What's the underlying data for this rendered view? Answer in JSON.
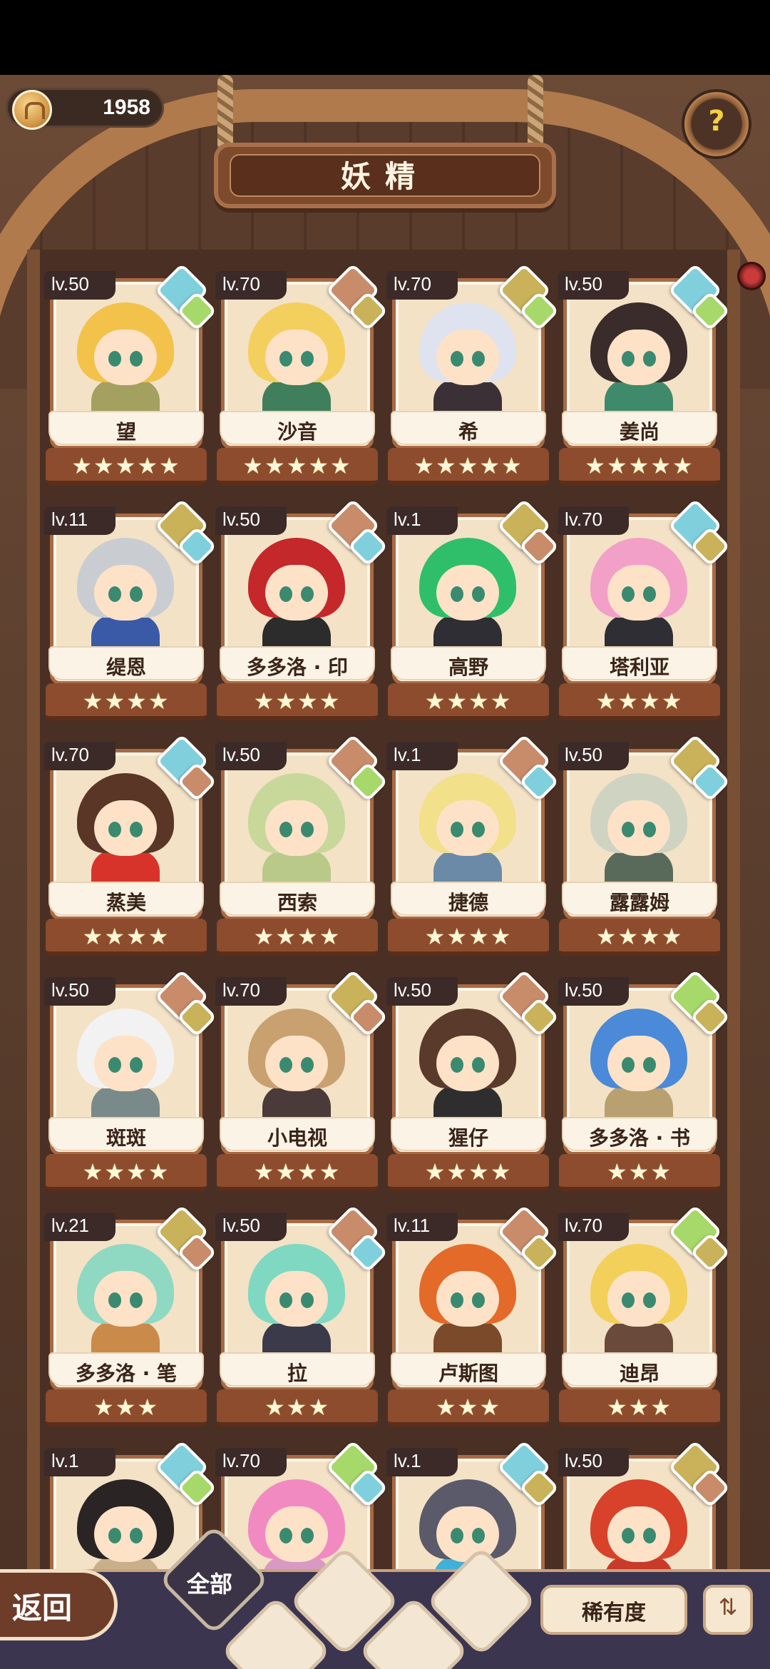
{
  "header": {
    "currency_value": "1958",
    "title": "妖精",
    "help_label": "?"
  },
  "colors": {
    "water": "#7fd0dc",
    "wind": "#a7d86a",
    "earth": "#c9b25a",
    "fire": "#c98c6a"
  },
  "cards": [
    {
      "lv": "lv.50",
      "name": "望",
      "stars": 5,
      "elem1": "water",
      "elem2": "wind",
      "hair": "#f2c24a",
      "body": "#a3a060"
    },
    {
      "lv": "lv.70",
      "name": "沙音",
      "stars": 5,
      "elem1": "fire",
      "elem2": "earth",
      "hair": "#f3cf5e",
      "body": "#3f7f5c"
    },
    {
      "lv": "lv.70",
      "name": "希",
      "stars": 5,
      "elem1": "earth",
      "elem2": "wind",
      "hair": "#dfe3ef",
      "body": "#3a3036"
    },
    {
      "lv": "lv.50",
      "name": "姜尚",
      "stars": 5,
      "elem1": "water",
      "elem2": "wind",
      "hair": "#3a2c2a",
      "body": "#3f8a6a"
    },
    {
      "lv": "lv.11",
      "name": "缇恩",
      "stars": 4,
      "elem1": "earth",
      "elem2": "water",
      "hair": "#c9cdd2",
      "body": "#3a5aa8"
    },
    {
      "lv": "lv.50",
      "name": "多多洛 · 印",
      "stars": 4,
      "elem1": "fire",
      "elem2": "water",
      "hair": "#c4282a",
      "body": "#2c2c2c"
    },
    {
      "lv": "lv.1",
      "name": "高野",
      "stars": 4,
      "elem1": "earth",
      "elem2": "fire",
      "hair": "#2fbf6a",
      "body": "#2e2e34"
    },
    {
      "lv": "lv.70",
      "name": "塔利亚",
      "stars": 4,
      "elem1": "water",
      "elem2": "earth",
      "hair": "#f2a0c8",
      "body": "#2e2e34"
    },
    {
      "lv": "lv.70",
      "name": "蒸美",
      "stars": 4,
      "elem1": "water",
      "elem2": "fire",
      "hair": "#5a3626",
      "body": "#d8332a"
    },
    {
      "lv": "lv.50",
      "name": "西索",
      "stars": 4,
      "elem1": "fire",
      "elem2": "wind",
      "hair": "#c7d89a",
      "body": "#b8c98a"
    },
    {
      "lv": "lv.1",
      "name": "捷德",
      "stars": 4,
      "elem1": "fire",
      "elem2": "water",
      "hair": "#f2e08a",
      "body": "#6a8aa8"
    },
    {
      "lv": "lv.50",
      "name": "露露姆",
      "stars": 4,
      "elem1": "earth",
      "elem2": "water",
      "hair": "#cfd3c2",
      "body": "#5a6a5a"
    },
    {
      "lv": "lv.50",
      "name": "斑斑",
      "stars": 4,
      "elem1": "fire",
      "elem2": "earth",
      "hair": "#f2f2f2",
      "body": "#7a8a8a"
    },
    {
      "lv": "lv.70",
      "name": "小电视",
      "stars": 4,
      "elem1": "earth",
      "elem2": "fire",
      "hair": "#c9a070",
      "body": "#4a3a3a"
    },
    {
      "lv": "lv.50",
      "name": "猩仔",
      "stars": 4,
      "elem1": "fire",
      "elem2": "earth",
      "hair": "#5a3a2a",
      "body": "#2e2e2e"
    },
    {
      "lv": "lv.50",
      "name": "多多洛 · 书",
      "stars": 3,
      "elem1": "wind",
      "elem2": "earth",
      "hair": "#4a8ad8",
      "body": "#b8a070"
    },
    {
      "lv": "lv.21",
      "name": "多多洛 · 笔",
      "stars": 3,
      "elem1": "earth",
      "elem2": "fire",
      "hair": "#8fd8c2",
      "body": "#c98a4a"
    },
    {
      "lv": "lv.50",
      "name": "拉",
      "stars": 3,
      "elem1": "fire",
      "elem2": "water",
      "hair": "#7fd8c2",
      "body": "#3a3a4a"
    },
    {
      "lv": "lv.11",
      "name": "卢斯图",
      "stars": 3,
      "elem1": "fire",
      "elem2": "earth",
      "hair": "#e46a2a",
      "body": "#7a4a2a"
    },
    {
      "lv": "lv.70",
      "name": "迪昂",
      "stars": 3,
      "elem1": "wind",
      "elem2": "earth",
      "hair": "#f2d05a",
      "body": "#6a4a3a"
    },
    {
      "lv": "lv.1",
      "name": "",
      "stars": 0,
      "elem1": "water",
      "elem2": "wind",
      "hair": "#2a2424",
      "body": "#c9b08a"
    },
    {
      "lv": "lv.70",
      "name": "",
      "stars": 0,
      "elem1": "wind",
      "elem2": "water",
      "hair": "#f28ac2",
      "body": "#d89ac2"
    },
    {
      "lv": "lv.1",
      "name": "",
      "stars": 0,
      "elem1": "water",
      "elem2": "earth",
      "hair": "#5a5a6a",
      "body": "#3fb0d8"
    },
    {
      "lv": "lv.50",
      "name": "",
      "stars": 0,
      "elem1": "earth",
      "elem2": "fire",
      "hair": "#d8422a",
      "body": "#c83a2a"
    }
  ],
  "bottom": {
    "back_label": "返回",
    "filter_all": "全部",
    "rarity_label": "稀有度",
    "sort_icon": "⇅"
  }
}
